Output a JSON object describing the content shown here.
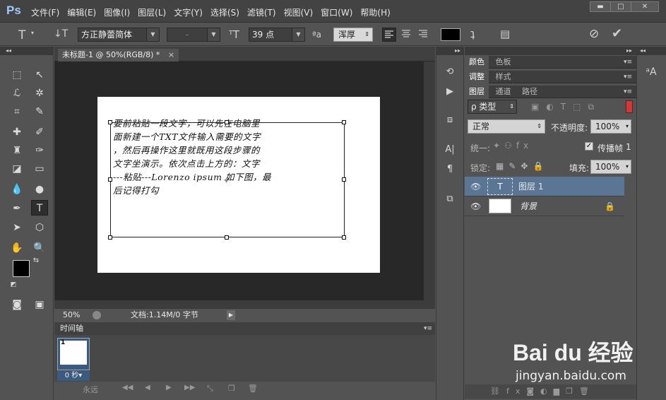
{
  "app": {
    "logo": "Ps"
  },
  "menu": [
    "文件(F)",
    "编辑(E)",
    "图像(I)",
    "图层(L)",
    "文字(Y)",
    "选择(S)",
    "滤镜(T)",
    "视图(V)",
    "窗口(W)",
    "帮助(H)"
  ],
  "window_buttons": {
    "minimize": "▬",
    "restore": "□",
    "close": "✕"
  },
  "options": {
    "font_family": "方正静蕾简体",
    "font_style": "-",
    "font_size": "39 点",
    "aa_label": "ªa",
    "antialias": "浑厚"
  },
  "document": {
    "tab_title": "未标题-1 @ 50%(RGB/8) *",
    "tab_close": "×",
    "text_lines": [
      "要前粘贴一段文字，可以先在电脑里",
      "面新建一个TXT文件输入需要的文字",
      "，然后再操作这里就既用这段步骤的",
      "文字坐演示。依次点击上方的：文字",
      "---粘贴---Lorenzo ipsum 如下图，最",
      "后记得打勾"
    ]
  },
  "status": {
    "zoom": "50%",
    "doc_info": "文档:1.14M/0 字节"
  },
  "timeline": {
    "title": "时间轴",
    "frame_number": "1",
    "frame_delay": "0 秒▾",
    "loop": "永远"
  },
  "panels": {
    "group1": [
      "颜色",
      "色板"
    ],
    "group2": [
      "调整",
      "样式"
    ],
    "group3": [
      "图层",
      "通道",
      "路径"
    ],
    "kind_label": "ρ 类型",
    "blend_mode": "正常",
    "opacity_label": "不透明度:",
    "opacity_value": "100%",
    "unify_label": "统一:",
    "propagate_label": "传播帧",
    "propagate_value": "1",
    "lock_label": "锁定:",
    "fill_label": "填充:",
    "fill_value": "100%"
  },
  "layers": [
    {
      "name": "图层 1",
      "type": "text",
      "selected": true
    },
    {
      "name": "背景",
      "type": "background",
      "locked": true
    }
  ],
  "watermark": {
    "brand": "Bai du 经验",
    "url": "jingyan.baidu.com"
  }
}
